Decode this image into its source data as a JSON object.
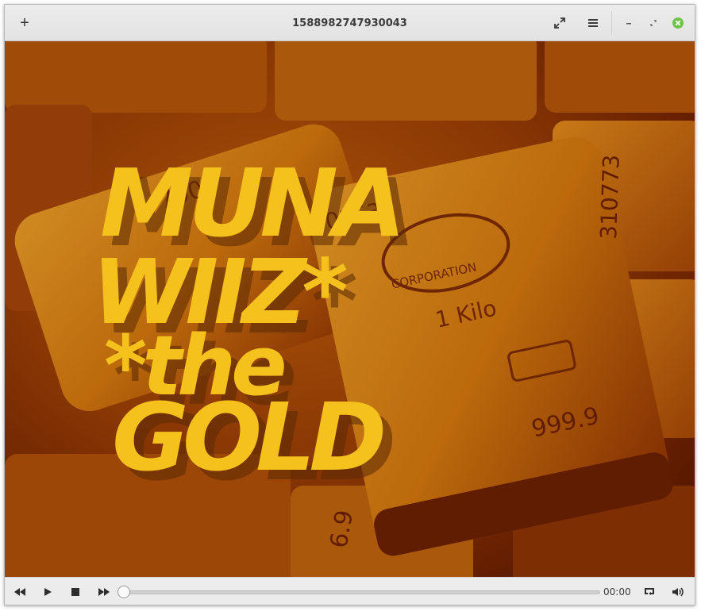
{
  "window": {
    "title": "1588982747930043",
    "new_tab_label": "+",
    "fullscreen_icon": "fullscreen-icon",
    "menu_icon": "hamburger-menu-icon",
    "minimize_icon": "minimize-icon",
    "restore_icon": "restore-icon",
    "close_icon": "close-icon",
    "close_color": "#6ec34a"
  },
  "video": {
    "artwork_text_lines": [
      "MUNA",
      "WIIZ*",
      "*the",
      "GOLD"
    ],
    "bar_numbers": [
      "7001",
      "0153",
      "1 Kilo",
      "999.9",
      "310773",
      "6.9"
    ],
    "bar_stamp": "CORPORATION",
    "accent_yellow": "#f5c11c"
  },
  "controls": {
    "rewind_icon": "rewind-icon",
    "play_icon": "play-icon",
    "stop_icon": "stop-icon",
    "forward_icon": "fast-forward-icon",
    "time": "00:00",
    "progress": 0,
    "repeat_icon": "repeat-icon",
    "volume_icon": "volume-icon"
  }
}
